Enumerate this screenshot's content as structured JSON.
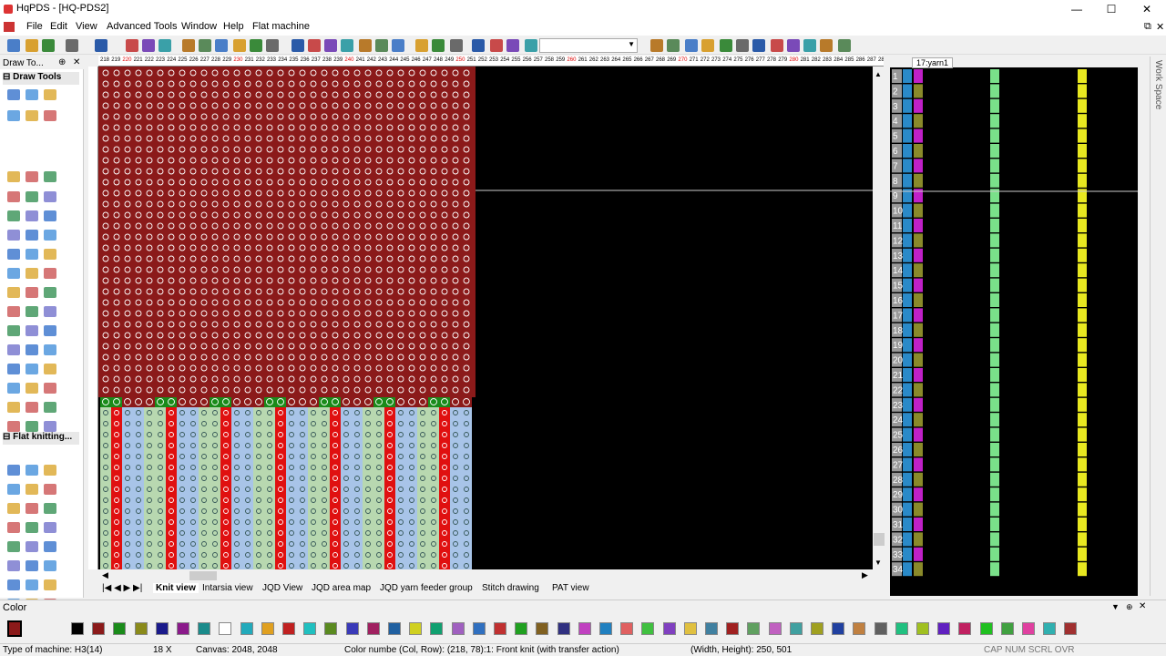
{
  "window": {
    "title": "HqPDS - [HQ-PDS2]",
    "min": "—",
    "max": "☐",
    "close": "✕"
  },
  "menu": [
    "File",
    "Edit",
    "View",
    "Advanced Tools",
    "Window",
    "Help",
    "Flat machine"
  ],
  "left_panel": {
    "title": "Draw To...",
    "pin": "⊕",
    "close": "✕",
    "section1": "Draw Tools",
    "section2": "Flat knitting..."
  },
  "ruler": {
    "start": 218,
    "end": 288,
    "red_marks": [
      220,
      230,
      240,
      250,
      260,
      270,
      280
    ]
  },
  "canvas": {
    "description_columns": 70
  },
  "tabs": [
    "Knit view",
    "Intarsia view",
    "JQD View",
    "JQD area map",
    "JQD yarn feeder group",
    "Stitch drawing",
    "PAT view"
  ],
  "active_tab": "Knit view",
  "right_panel": {
    "header": "17:yarn1",
    "rows": [
      1,
      2,
      3,
      4,
      5,
      6,
      7,
      8,
      9,
      10,
      11,
      12,
      13,
      14,
      15,
      16,
      17,
      18,
      19,
      20,
      21,
      22,
      23,
      24,
      25,
      26,
      27,
      28,
      29,
      30,
      31,
      32,
      33,
      34
    ]
  },
  "workspace_label": "Work Space",
  "color_panel": {
    "title": "Color",
    "count": 48
  },
  "status": {
    "machine": "Type of machine: H3(14)",
    "zoom": "18 X",
    "canvas": "Canvas: 2048, 2048",
    "color": "Color numbe (Col, Row): (218, 78):1: Front knit (with transfer action)",
    "size": "(Width, Height): 250, 501",
    "keys": "CAP  NUM  SCRL  OVR"
  },
  "colors": {
    "red": "#8b1a1a",
    "green": "#1a8b1a",
    "blue": "#a8c4e8",
    "lightgreen": "#b8d8b0",
    "brightred": "#e01010"
  }
}
